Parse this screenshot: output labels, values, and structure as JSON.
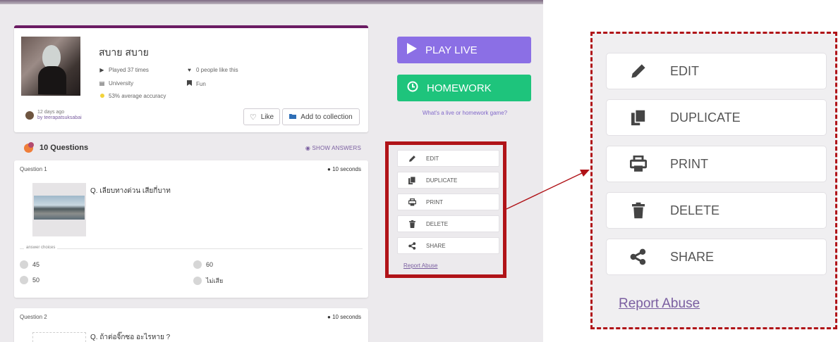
{
  "quiz": {
    "title": "สบาย สบาย",
    "played": "Played 37 times",
    "likes": "0 people like this",
    "grade": "University",
    "subject": "Fun",
    "accuracy": "53% average accuracy",
    "created": "12 days ago",
    "author": "by teerapatsuksabai",
    "like_label": "Like",
    "add_collection_label": "Add to collection"
  },
  "questions_header": {
    "count_label": "10 Questions",
    "show_answers_label": "SHOW ANSWERS"
  },
  "questions": [
    {
      "label": "Question 1",
      "time": "10 seconds",
      "text": "Q. เลียบทางด่วน เสียกี่บาท",
      "choices_label": "answer choices",
      "choices": [
        "45",
        "60",
        "50",
        "ไม่เสีย"
      ]
    },
    {
      "label": "Question 2",
      "time": "10 seconds",
      "text": "Q. ถ้าต่อจิ๊กซอ อะไรหาย ?"
    }
  ],
  "right_panel": {
    "play_live_label": "PLAY LIVE",
    "homework_label": "HOMEWORK",
    "what_link": "What's a live or homework game?"
  },
  "actions": {
    "edit": "EDIT",
    "duplicate": "DUPLICATE",
    "print": "PRINT",
    "delete": "DELETE",
    "share": "SHARE",
    "report": "Report Abuse"
  },
  "colors": {
    "play_live": "#8b6fe5",
    "homework": "#1ec47c",
    "highlight": "#b01318",
    "link": "#7a5ea0",
    "card_top_border": "#6b1c63"
  },
  "icons": {
    "edit": "pencil-icon",
    "duplicate": "copy-icon",
    "print": "printer-icon",
    "delete": "trash-icon",
    "share": "share-icon"
  }
}
